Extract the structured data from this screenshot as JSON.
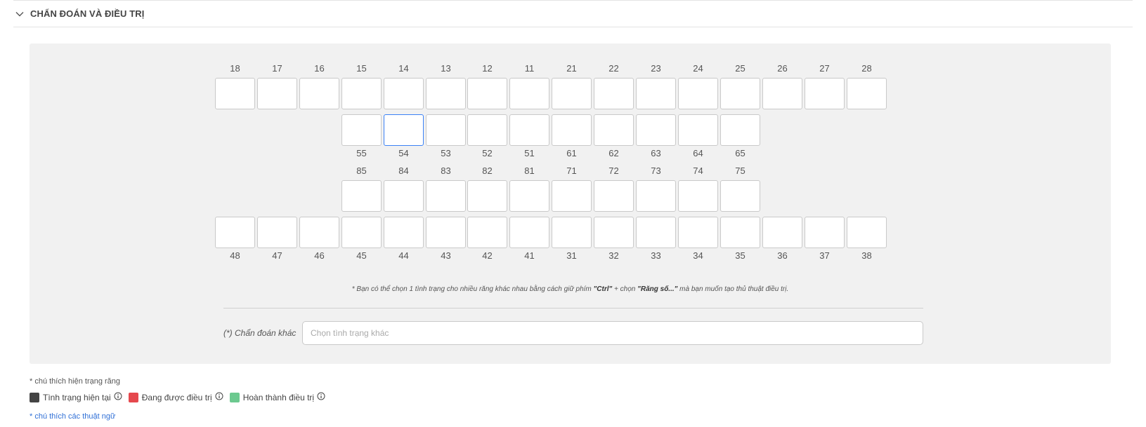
{
  "section": {
    "title": "CHẨN ĐOÁN VÀ ĐIỀU TRỊ"
  },
  "teeth": {
    "upper_permanent": [
      "18",
      "17",
      "16",
      "15",
      "14",
      "13",
      "12",
      "11",
      "21",
      "22",
      "23",
      "24",
      "25",
      "26",
      "27",
      "28"
    ],
    "upper_primary": [
      "55",
      "54",
      "53",
      "52",
      "51",
      "61",
      "62",
      "63",
      "64",
      "65"
    ],
    "lower_primary": [
      "85",
      "84",
      "83",
      "82",
      "81",
      "71",
      "72",
      "73",
      "74",
      "75"
    ],
    "lower_permanent": [
      "48",
      "47",
      "46",
      "45",
      "44",
      "43",
      "42",
      "41",
      "31",
      "32",
      "33",
      "34",
      "35",
      "36",
      "37",
      "38"
    ],
    "selected": "54"
  },
  "hint": {
    "prefix": "* Bạn có thể chọn 1 tình trạng cho nhiều răng khác nhau bằng cách giữ phím ",
    "ctrl": "\"Ctrl\"",
    "middle": " + chọn ",
    "tooth": "\"Răng số...\"",
    "suffix": " mà bạn muốn tạo thủ thuật điều trị."
  },
  "other_diagnosis": {
    "label": "(*) Chẩn đoán khác",
    "placeholder": "Chọn tình trạng khác",
    "value": ""
  },
  "legend": {
    "note": "* chú thích hiện trạng răng",
    "items": [
      {
        "label": "Tình trạng hiện tại",
        "color": "#444444"
      },
      {
        "label": "Đang được điều trị",
        "color": "#e5484d"
      },
      {
        "label": "Hoàn thành điều trị",
        "color": "#6cc98f"
      }
    ],
    "terms_link": "* chú thích các thuật ngữ"
  }
}
